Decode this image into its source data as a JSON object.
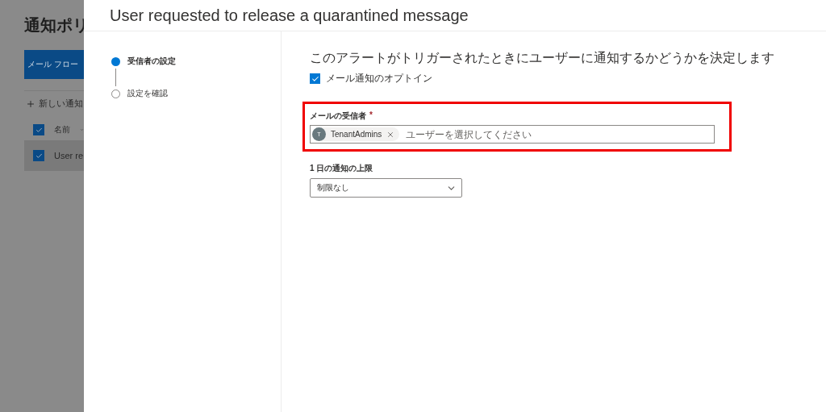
{
  "background_page": {
    "title": "通知ポリ",
    "primary_button": "メール フロー",
    "new_button": "新しい通知",
    "column_header": {
      "label": "名前",
      "checked": true
    },
    "rows": [
      {
        "name": "User re",
        "checked": true
      }
    ]
  },
  "panel": {
    "title": "User requested to release a quarantined message",
    "steps": [
      {
        "label": "受信者の設定",
        "selected": true
      },
      {
        "label": "設定を確認",
        "selected": false
      }
    ],
    "heading": "このアラートがトリガーされたときにユーザーに通知するかどうかを決定します",
    "opt_in": {
      "label": "メール通知のオプトイン",
      "checked": true
    },
    "recipients": {
      "label": "メールの受信者",
      "required": "*",
      "chips": [
        {
          "initial": "T",
          "name": "TenantAdmins"
        }
      ],
      "placeholder": "ユーザーを選択してください",
      "highlighted": true
    },
    "daily_limit": {
      "label": "1 日の通知の上限",
      "value": "制限なし"
    }
  }
}
